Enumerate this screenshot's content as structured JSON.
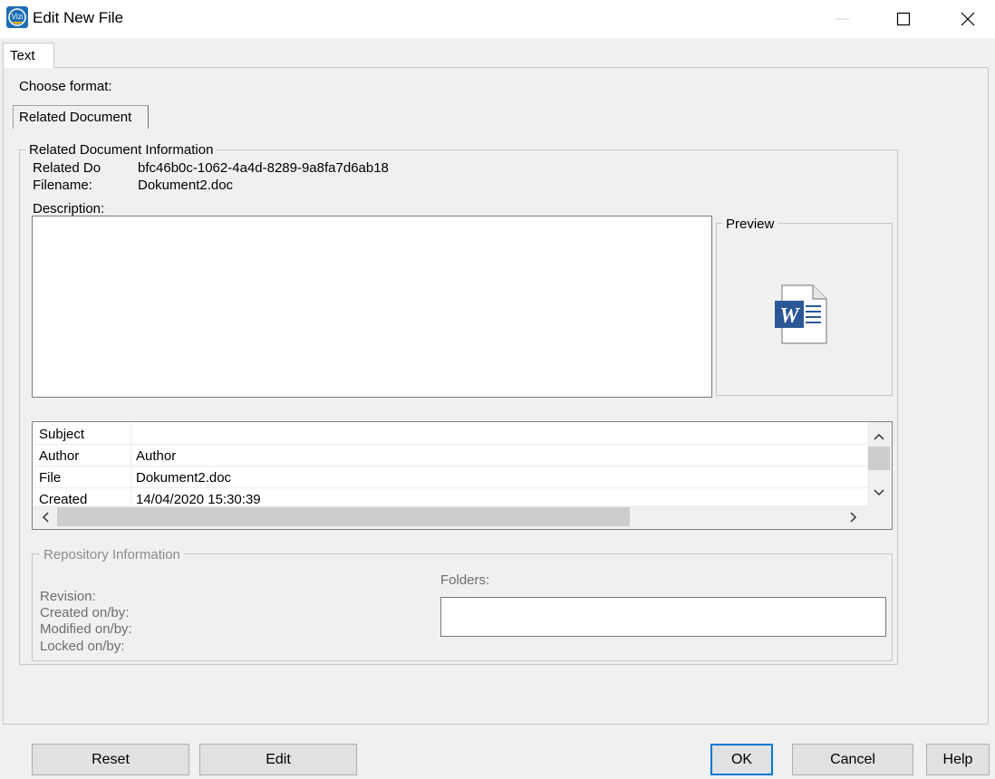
{
  "window": {
    "title": "Edit New File",
    "app_icon_text": "Vizi"
  },
  "tabs": [
    {
      "label": "Text"
    }
  ],
  "choose_format_label": "Choose format:",
  "format_tab_label": "Related Document",
  "related_doc": {
    "group_title": "Related Document Information",
    "id_label": "Related Do",
    "id_value": "bfc46b0c-1062-4a4d-8289-9a8fa7d6ab18",
    "filename_label": "Filename:",
    "filename_value": "Dokument2.doc",
    "description_label": "Description:",
    "description_value": ""
  },
  "preview": {
    "title": "Preview",
    "icon": "word-document-icon",
    "icon_letter": "W"
  },
  "properties": [
    {
      "key": "Subject",
      "value": ""
    },
    {
      "key": "Author",
      "value": "Author"
    },
    {
      "key": "File",
      "value": "Dokument2.doc"
    },
    {
      "key": "Created",
      "value": "14/04/2020 15:30:39"
    }
  ],
  "repository": {
    "group_title": "Repository Information",
    "revision_label": "Revision:",
    "created_label": "Created on/by:",
    "modified_label": "Modified on/by:",
    "locked_label": "Locked on/by:",
    "folders_label": "Folders:",
    "folders_value": ""
  },
  "buttons": {
    "reset": "Reset",
    "edit": "Edit",
    "ok": "OK",
    "cancel": "Cancel",
    "help": "Help"
  },
  "colors": {
    "accent": "#0078d7",
    "word_blue": "#2b5797"
  }
}
